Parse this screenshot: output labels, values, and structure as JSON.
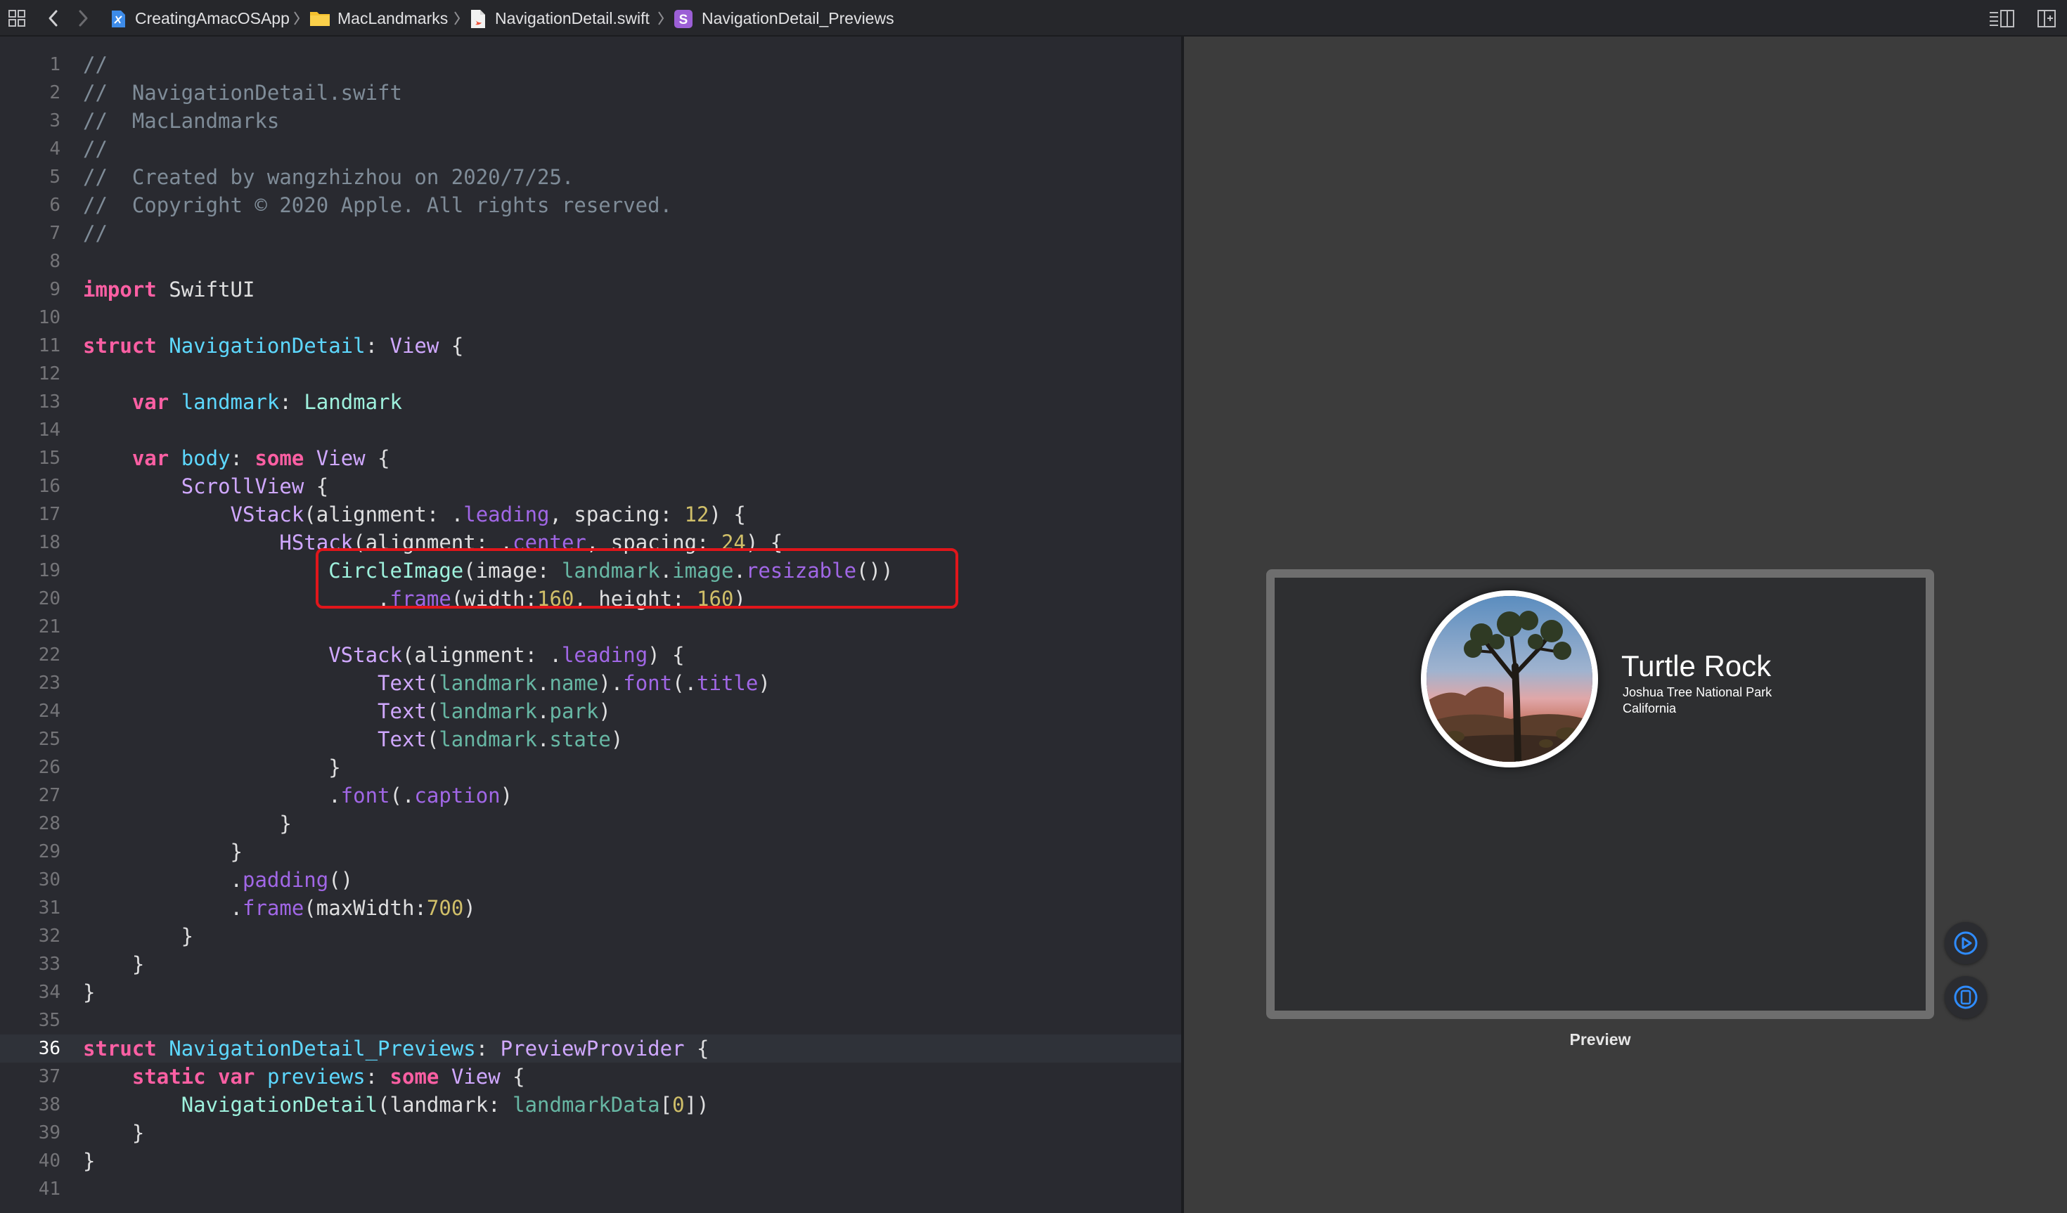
{
  "jumpbar": {
    "crumbs": [
      {
        "label": "CreatingAmacOSApp",
        "icon": "xcode-project-icon"
      },
      {
        "label": "MacLandmarks",
        "icon": "folder-icon"
      },
      {
        "label": "NavigationDetail.swift",
        "icon": "swift-file-icon"
      },
      {
        "label": "NavigationDetail_Previews",
        "icon": "struct-symbol-icon",
        "icon_letter": "S"
      }
    ],
    "left_icons": [
      "grid-icon",
      "back-arrow-icon",
      "forward-arrow-icon"
    ],
    "right_icons": [
      "editor-options-icon",
      "add-editor-icon"
    ]
  },
  "editor": {
    "current_line": 36,
    "lines": [
      {
        "n": "1",
        "tokens": [
          [
            "comment",
            "//"
          ]
        ]
      },
      {
        "n": "2",
        "tokens": [
          [
            "comment",
            "//  NavigationDetail.swift"
          ]
        ]
      },
      {
        "n": "3",
        "tokens": [
          [
            "comment",
            "//  MacLandmarks"
          ]
        ]
      },
      {
        "n": "4",
        "tokens": [
          [
            "comment",
            "//"
          ]
        ]
      },
      {
        "n": "5",
        "tokens": [
          [
            "comment",
            "//  Created by wangzhizhou on 2020/7/25."
          ]
        ]
      },
      {
        "n": "6",
        "tokens": [
          [
            "comment",
            "//  Copyright © 2020 Apple. All rights reserved."
          ]
        ]
      },
      {
        "n": "7",
        "tokens": [
          [
            "comment",
            "//"
          ]
        ]
      },
      {
        "n": "8",
        "tokens": []
      },
      {
        "n": "9",
        "tokens": [
          [
            "keyword",
            "import"
          ],
          [
            "plain",
            " SwiftUI"
          ]
        ]
      },
      {
        "n": "10",
        "tokens": []
      },
      {
        "n": "11",
        "tokens": [
          [
            "keyword",
            "struct"
          ],
          [
            "plain",
            " "
          ],
          [
            "decl",
            "NavigationDetail"
          ],
          [
            "plain",
            ": "
          ],
          [
            "type",
            "View"
          ],
          [
            "plain",
            " {"
          ]
        ]
      },
      {
        "n": "12",
        "tokens": []
      },
      {
        "n": "13",
        "tokens": [
          [
            "plain",
            "    "
          ],
          [
            "keyword",
            "var"
          ],
          [
            "plain",
            " "
          ],
          [
            "decl",
            "landmark"
          ],
          [
            "plain",
            ": "
          ],
          [
            "projtype",
            "Landmark"
          ]
        ]
      },
      {
        "n": "14",
        "tokens": []
      },
      {
        "n": "15",
        "tokens": [
          [
            "plain",
            "    "
          ],
          [
            "keyword",
            "var"
          ],
          [
            "plain",
            " "
          ],
          [
            "decl",
            "body"
          ],
          [
            "plain",
            ": "
          ],
          [
            "keyword",
            "some"
          ],
          [
            "plain",
            " "
          ],
          [
            "type",
            "View"
          ],
          [
            "plain",
            " {"
          ]
        ]
      },
      {
        "n": "16",
        "tokens": [
          [
            "plain",
            "        "
          ],
          [
            "type",
            "ScrollView"
          ],
          [
            "plain",
            " {"
          ]
        ]
      },
      {
        "n": "17",
        "tokens": [
          [
            "plain",
            "            "
          ],
          [
            "type",
            "VStack"
          ],
          [
            "plain",
            "(alignment: ."
          ],
          [
            "method",
            "leading"
          ],
          [
            "plain",
            ", spacing: "
          ],
          [
            "number",
            "12"
          ],
          [
            "plain",
            ") {"
          ]
        ]
      },
      {
        "n": "18",
        "tokens": [
          [
            "plain",
            "                "
          ],
          [
            "type",
            "HStack"
          ],
          [
            "plain",
            "(alignment: ."
          ],
          [
            "method",
            "center"
          ],
          [
            "plain",
            ", spacing: "
          ],
          [
            "number",
            "24"
          ],
          [
            "plain",
            ") {"
          ]
        ]
      },
      {
        "n": "19",
        "tokens": [
          [
            "plain",
            "                    "
          ],
          [
            "projtype",
            "CircleImage"
          ],
          [
            "plain",
            "(image: "
          ],
          [
            "projmethod",
            "landmark"
          ],
          [
            "plain",
            "."
          ],
          [
            "projmethod",
            "image"
          ],
          [
            "plain",
            "."
          ],
          [
            "method",
            "resizable"
          ],
          [
            "plain",
            "())"
          ]
        ]
      },
      {
        "n": "20",
        "tokens": [
          [
            "plain",
            "                        ."
          ],
          [
            "method",
            "frame"
          ],
          [
            "plain",
            "(width:"
          ],
          [
            "number",
            "160"
          ],
          [
            "plain",
            ", height: "
          ],
          [
            "number",
            "160"
          ],
          [
            "plain",
            ")"
          ]
        ]
      },
      {
        "n": "21",
        "tokens": []
      },
      {
        "n": "22",
        "tokens": [
          [
            "plain",
            "                    "
          ],
          [
            "type",
            "VStack"
          ],
          [
            "plain",
            "(alignment: ."
          ],
          [
            "method",
            "leading"
          ],
          [
            "plain",
            ") {"
          ]
        ]
      },
      {
        "n": "23",
        "tokens": [
          [
            "plain",
            "                        "
          ],
          [
            "type",
            "Text"
          ],
          [
            "plain",
            "("
          ],
          [
            "projmethod",
            "landmark"
          ],
          [
            "plain",
            "."
          ],
          [
            "projmethod",
            "name"
          ],
          [
            "plain",
            ")."
          ],
          [
            "method",
            "font"
          ],
          [
            "plain",
            "(."
          ],
          [
            "method",
            "title"
          ],
          [
            "plain",
            ")"
          ]
        ]
      },
      {
        "n": "24",
        "tokens": [
          [
            "plain",
            "                        "
          ],
          [
            "type",
            "Text"
          ],
          [
            "plain",
            "("
          ],
          [
            "projmethod",
            "landmark"
          ],
          [
            "plain",
            "."
          ],
          [
            "projmethod",
            "park"
          ],
          [
            "plain",
            ")"
          ]
        ]
      },
      {
        "n": "25",
        "tokens": [
          [
            "plain",
            "                        "
          ],
          [
            "type",
            "Text"
          ],
          [
            "plain",
            "("
          ],
          [
            "projmethod",
            "landmark"
          ],
          [
            "plain",
            "."
          ],
          [
            "projmethod",
            "state"
          ],
          [
            "plain",
            ")"
          ]
        ]
      },
      {
        "n": "26",
        "tokens": [
          [
            "plain",
            "                    }"
          ]
        ]
      },
      {
        "n": "27",
        "tokens": [
          [
            "plain",
            "                    ."
          ],
          [
            "method",
            "font"
          ],
          [
            "plain",
            "(."
          ],
          [
            "method",
            "caption"
          ],
          [
            "plain",
            ")"
          ]
        ]
      },
      {
        "n": "28",
        "tokens": [
          [
            "plain",
            "                }"
          ]
        ]
      },
      {
        "n": "29",
        "tokens": [
          [
            "plain",
            "            }"
          ]
        ]
      },
      {
        "n": "30",
        "tokens": [
          [
            "plain",
            "            ."
          ],
          [
            "method",
            "padding"
          ],
          [
            "plain",
            "()"
          ]
        ]
      },
      {
        "n": "31",
        "tokens": [
          [
            "plain",
            "            ."
          ],
          [
            "method",
            "frame"
          ],
          [
            "plain",
            "(maxWidth:"
          ],
          [
            "number",
            "700"
          ],
          [
            "plain",
            ")"
          ]
        ]
      },
      {
        "n": "32",
        "tokens": [
          [
            "plain",
            "        }"
          ]
        ]
      },
      {
        "n": "33",
        "tokens": [
          [
            "plain",
            "    }"
          ]
        ]
      },
      {
        "n": "34",
        "tokens": [
          [
            "plain",
            "}"
          ]
        ]
      },
      {
        "n": "35",
        "tokens": []
      },
      {
        "n": "36",
        "tokens": [
          [
            "keyword",
            "struct"
          ],
          [
            "plain",
            " "
          ],
          [
            "decl",
            "NavigationDetail_Previews"
          ],
          [
            "plain",
            ": "
          ],
          [
            "type",
            "PreviewProvider"
          ],
          [
            "plain",
            " {"
          ]
        ]
      },
      {
        "n": "37",
        "tokens": [
          [
            "plain",
            "    "
          ],
          [
            "keyword",
            "static"
          ],
          [
            "plain",
            " "
          ],
          [
            "keyword",
            "var"
          ],
          [
            "plain",
            " "
          ],
          [
            "decl",
            "previews"
          ],
          [
            "plain",
            ": "
          ],
          [
            "keyword",
            "some"
          ],
          [
            "plain",
            " "
          ],
          [
            "type",
            "View"
          ],
          [
            "plain",
            " {"
          ]
        ]
      },
      {
        "n": "38",
        "tokens": [
          [
            "plain",
            "        "
          ],
          [
            "projtype",
            "NavigationDetail"
          ],
          [
            "plain",
            "(landmark: "
          ],
          [
            "projmethod",
            "landmarkData"
          ],
          [
            "plain",
            "["
          ],
          [
            "number",
            "0"
          ],
          [
            "plain",
            "])"
          ]
        ]
      },
      {
        "n": "39",
        "tokens": [
          [
            "plain",
            "    }"
          ]
        ]
      },
      {
        "n": "40",
        "tokens": [
          [
            "plain",
            "}"
          ]
        ]
      },
      {
        "n": "41",
        "tokens": []
      }
    ]
  },
  "preview": {
    "title": "Turtle Rock",
    "park": "Joshua Tree National Park",
    "state": "California",
    "label": "Preview"
  },
  "colors": {
    "editor_bg": "#292a30",
    "keyword": "#fc5fa3",
    "comment": "#7f8c98",
    "number": "#d0bf69",
    "highlight_box": "#e0161b",
    "canvas_bg": "#3c3c3c"
  }
}
